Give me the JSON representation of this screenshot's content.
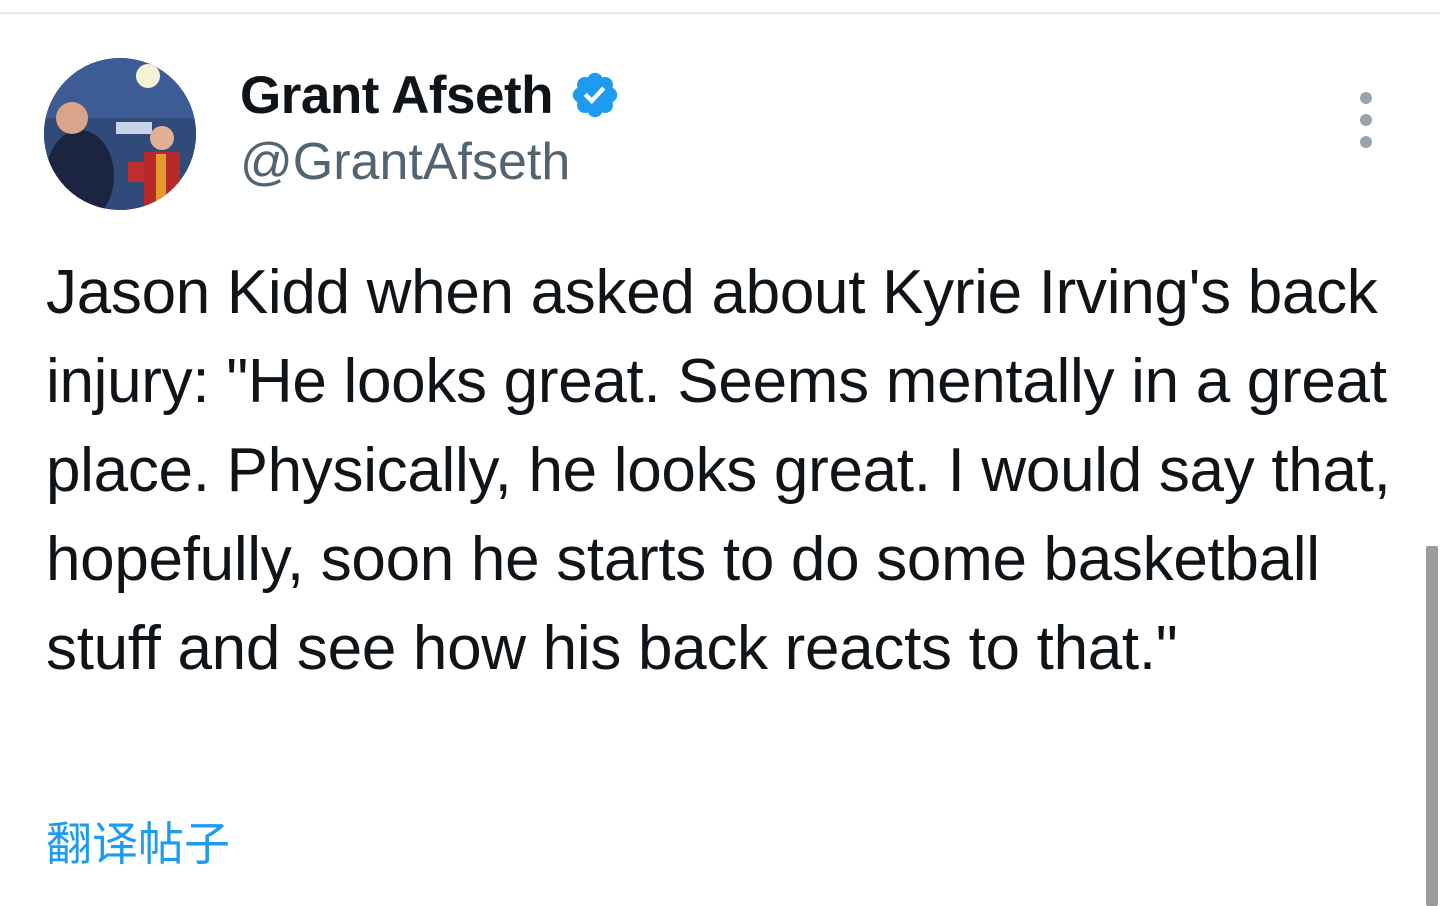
{
  "tweet": {
    "author": {
      "display_name": "Grant Afseth",
      "handle": "@GrantAfseth",
      "verified": true
    },
    "body": "Jason Kidd when asked about Kyrie Irving's back injury: \"He looks great. Seems mentally in a great place. Physically, he looks great. I would say that, hopefully, soon he starts to do some basketball stuff and see how his back reacts to that.\"",
    "translate_label": "翻译帖子"
  },
  "icons": {
    "verified": "verified-badge-icon",
    "more": "more-options-icon"
  },
  "colors": {
    "accent": "#1d9bf0",
    "text_primary": "#0f1419",
    "text_secondary": "#536471",
    "verified_badge": "#1d9bf0"
  }
}
